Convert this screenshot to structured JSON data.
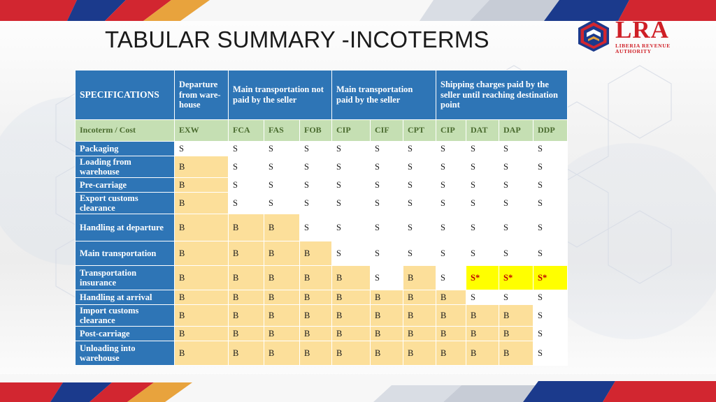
{
  "slide": {
    "title": "TABULAR SUMMARY -INCOTERMS",
    "logo": {
      "name": "LRA",
      "subtitle": "LIBERIA REVENUE AUTHORITY",
      "mark_icon": "lra-hexagon-logo-icon",
      "red": "#cf1f26",
      "blue": "#1b3a8c"
    },
    "accent_colors": {
      "header_blue": "#2e75b6",
      "subheader_green": "#c5dfb3",
      "amber": "#fcdf9a",
      "yellow": "#ffff00",
      "red_text": "#c00000"
    }
  },
  "table": {
    "group_headers": [
      "SPECIFICATIONS",
      "Departure from ware-house",
      "Main transportation not paid by the seller",
      "Main transportation paid by the seller",
      "Shipping charges paid by the seller until reaching destination point"
    ],
    "incoterm_label": "Incoterm / Cost",
    "incoterms": [
      "EXW",
      "FCA",
      "FAS",
      "FOB",
      "CIP",
      "CIF",
      "CPT",
      "CIP",
      "DAT",
      "DAP",
      "DDP"
    ],
    "rows": [
      {
        "label": "Packaging",
        "values": [
          "S",
          "S",
          "S",
          "S",
          "S",
          "S",
          "S",
          "S",
          "S",
          "S",
          "S"
        ],
        "fills": [
          "white",
          "white",
          "white",
          "white",
          "white",
          "white",
          "white",
          "white",
          "white",
          "white",
          "white"
        ]
      },
      {
        "label": "Loading from warehouse",
        "values": [
          "B",
          "S",
          "S",
          "S",
          "S",
          "S",
          "S",
          "S",
          "S",
          "S",
          "S"
        ],
        "fills": [
          "amber",
          "white",
          "white",
          "white",
          "white",
          "white",
          "white",
          "white",
          "white",
          "white",
          "white"
        ]
      },
      {
        "label": "Pre-carriage",
        "values": [
          "B",
          "S",
          "S",
          "S",
          "S",
          "S",
          "S",
          "S",
          "S",
          "S",
          "S"
        ],
        "fills": [
          "amber",
          "white",
          "white",
          "white",
          "white",
          "white",
          "white",
          "white",
          "white",
          "white",
          "white"
        ]
      },
      {
        "label": "Export customs clearance",
        "values": [
          "B",
          "S",
          "S",
          "S",
          "S",
          "S",
          "S",
          "S",
          "S",
          "S",
          "S"
        ],
        "fills": [
          "amber",
          "white",
          "white",
          "white",
          "white",
          "white",
          "white",
          "white",
          "white",
          "white",
          "white"
        ]
      },
      {
        "label": "Handling at departure",
        "values": [
          "B",
          "B",
          "B",
          "S",
          "S",
          "S",
          "S",
          "S",
          "S",
          "S",
          "S"
        ],
        "fills": [
          "amber",
          "amber",
          "amber",
          "white",
          "white",
          "white",
          "white",
          "white",
          "white",
          "white",
          "white"
        ]
      },
      {
        "label": "Main transportation",
        "values": [
          "B",
          "B",
          "B",
          "B",
          "S",
          "S",
          "S",
          "S",
          "S",
          "S",
          "S"
        ],
        "fills": [
          "amber",
          "amber",
          "amber",
          "amber",
          "white",
          "white",
          "white",
          "white",
          "white",
          "white",
          "white"
        ]
      },
      {
        "label": "Transportation insurance",
        "values": [
          "B",
          "B",
          "B",
          "B",
          "B",
          "S",
          "B",
          "S",
          "S*",
          "S*",
          "S*"
        ],
        "fills": [
          "amber",
          "amber",
          "amber",
          "amber",
          "amber",
          "white",
          "amber",
          "white",
          "yellow",
          "yellow",
          "yellow"
        ]
      },
      {
        "label": "Handling at arrival",
        "values": [
          "B",
          "B",
          "B",
          "B",
          "B",
          "B",
          "B",
          "B",
          "S",
          "S",
          "S"
        ],
        "fills": [
          "amber",
          "amber",
          "amber",
          "amber",
          "amber",
          "amber",
          "amber",
          "amber",
          "white",
          "white",
          "white"
        ]
      },
      {
        "label": "Import customs clearance",
        "values": [
          "B",
          "B",
          "B",
          "B",
          "B",
          "B",
          "B",
          "B",
          "B",
          "B",
          "S"
        ],
        "fills": [
          "amber",
          "amber",
          "amber",
          "amber",
          "amber",
          "amber",
          "amber",
          "amber",
          "amber",
          "amber",
          "white"
        ]
      },
      {
        "label": "Post-carriage",
        "values": [
          "B",
          "B",
          "B",
          "B",
          "B",
          "B",
          "B",
          "B",
          "B",
          "B",
          "S"
        ],
        "fills": [
          "amber",
          "amber",
          "amber",
          "amber",
          "amber",
          "amber",
          "amber",
          "amber",
          "amber",
          "amber",
          "white"
        ]
      },
      {
        "label": "Unloading into warehouse",
        "values": [
          "B",
          "B",
          "B",
          "B",
          "B",
          "B",
          "B",
          "B",
          "B",
          "B",
          "S"
        ],
        "fills": [
          "amber",
          "amber",
          "amber",
          "amber",
          "amber",
          "amber",
          "amber",
          "amber",
          "amber",
          "amber",
          "white"
        ]
      }
    ]
  }
}
